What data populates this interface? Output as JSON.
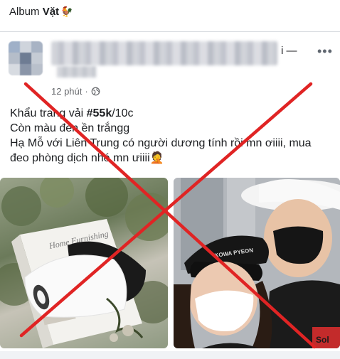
{
  "album": {
    "prefix": "Album",
    "title": "Vặt"
  },
  "header": {
    "name_trailing": "i —",
    "time": "12 phút",
    "separator": "·"
  },
  "post": {
    "line1_prefix": "Khẩu trang vải ",
    "line1_hash": "#55k",
    "line1_suffix": "/10c",
    "line2": "Còn màu đen ền trắngg",
    "line3": "Hạ Mỗ với Liên Trung có người dương tính rồi mn ơiiii, mua",
    "line4": "đeo phòng dịch nhé mn ưiiii"
  },
  "photos": {
    "left_box_text": "Home Furnishing",
    "right_cap_text": "KOWA PYEON",
    "right_shirt_text": "Sol"
  },
  "colors": {
    "cross": "#e02424",
    "meta_text": "#65676b",
    "divider": "#d9dce1"
  },
  "icons": [
    "more-dots-icon",
    "globe-icon",
    "emoji-icon"
  ]
}
